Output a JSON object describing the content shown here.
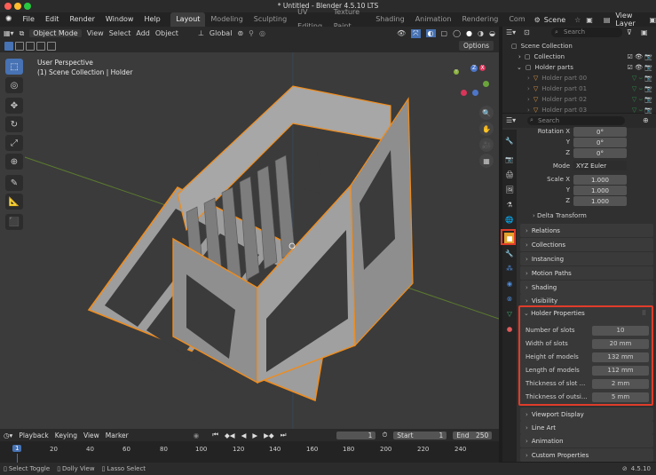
{
  "window": {
    "title": "* Untitled - Blender 4.5.10 LTS"
  },
  "menu": [
    "File",
    "Edit",
    "Render",
    "Window",
    "Help"
  ],
  "workspaces": [
    "Layout",
    "Modeling",
    "Sculpting",
    "UV Editing",
    "Texture Paint",
    "Shading",
    "Animation",
    "Rendering",
    "Com"
  ],
  "scene": {
    "label": "Scene",
    "view_layer": "View Layer"
  },
  "viewport_header": {
    "mode": "Object Mode",
    "items": [
      "View",
      "Select",
      "Add",
      "Object"
    ],
    "transform": "Global",
    "options": "Options"
  },
  "viewport": {
    "perspective": "User Perspective",
    "collection_info": "(1) Scene Collection | Holder",
    "axes": {
      "z": "Z",
      "y": "Y",
      "x": "X"
    }
  },
  "outliner": {
    "search_placeholder": "Search",
    "rows": [
      "Scene Collection",
      "Collection",
      "Holder parts",
      "Holder part 00",
      "Holder part 01",
      "Holder part 02",
      "Holder part 03"
    ]
  },
  "properties": {
    "search_placeholder": "Search",
    "rotation": {
      "label_x": "Rotation X",
      "label_y": "Y",
      "label_z": "Z",
      "x": "0°",
      "y": "0°",
      "z": "0°"
    },
    "mode": {
      "label": "Mode",
      "value": "XYZ Euler"
    },
    "scale": {
      "label_x": "Scale X",
      "label_y": "Y",
      "label_z": "Z",
      "x": "1.000",
      "y": "1.000",
      "z": "1.000"
    },
    "delta_transform": "Delta Transform",
    "panels_top": [
      "Relations",
      "Collections",
      "Instancing",
      "Motion Paths",
      "Shading",
      "Visibility"
    ],
    "holder_properties": {
      "title": "Holder Properties",
      "rows": [
        {
          "label": "Number of slots",
          "value": "10"
        },
        {
          "label": "Width of slots",
          "value": "20 mm"
        },
        {
          "label": "Height of models",
          "value": "132 mm"
        },
        {
          "label": "Length of models",
          "value": "112 mm"
        },
        {
          "label": "Thickness of slot ...",
          "value": "2 mm"
        },
        {
          "label": "Thickness of outsi...",
          "value": "5 mm"
        }
      ]
    },
    "panels_bottom": [
      "Viewport Display",
      "Line Art",
      "Animation",
      "Custom Properties"
    ]
  },
  "timeline": {
    "items": [
      "Playback",
      "Keying",
      "View",
      "Marker"
    ],
    "current_frame": "1",
    "start_label": "Start",
    "start": "1",
    "end_label": "End",
    "end": "250",
    "ruler": [
      "1",
      "20",
      "40",
      "60",
      "80",
      "100",
      "120",
      "140",
      "160",
      "180",
      "200",
      "220",
      "240"
    ]
  },
  "statusbar": {
    "items": [
      "Select Toggle",
      "Dolly View",
      "Lasso Select"
    ],
    "version": "4.5.10"
  },
  "colors": {
    "accent": "#4772b3",
    "highlight": "#e03c2a",
    "selection_outline": "#f08c1c"
  }
}
